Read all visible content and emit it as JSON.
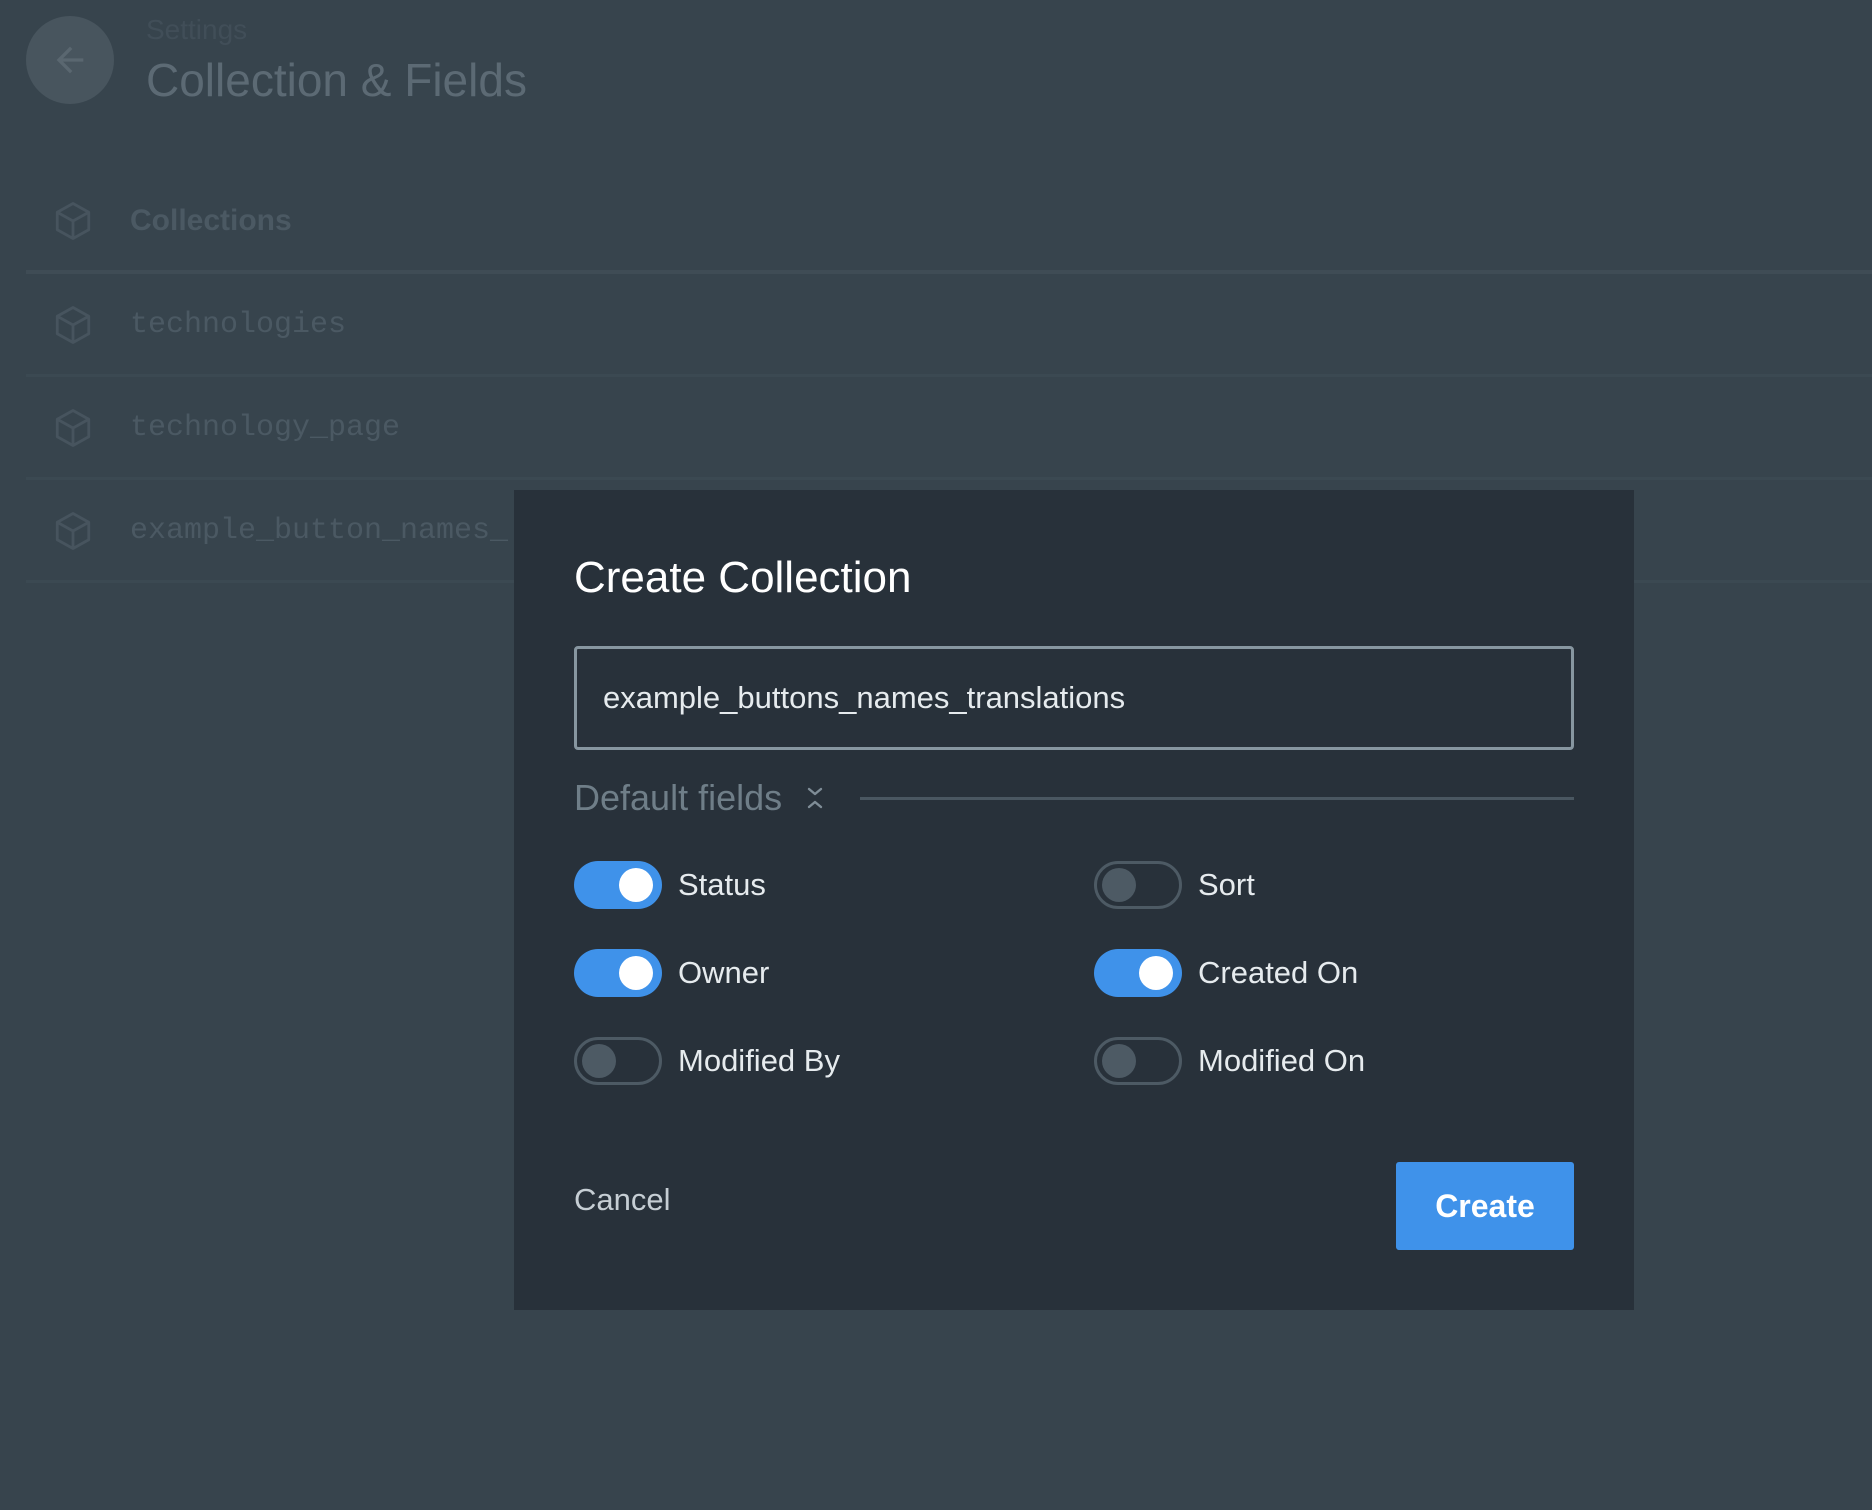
{
  "header": {
    "breadcrumb": "Settings",
    "title": "Collection & Fields",
    "back_icon": "arrow-left-icon"
  },
  "collections": {
    "header_label": "Collections",
    "items": [
      {
        "name": "technologies"
      },
      {
        "name": "technology_page"
      },
      {
        "name": "example_button_names_"
      }
    ],
    "item_icon": "cube-icon"
  },
  "modal": {
    "title": "Create Collection",
    "name_input": {
      "value": "example_buttons_names_translations",
      "placeholder": ""
    },
    "default_fields_label": "Default fields",
    "collapse_icon": "unfold-less-icon",
    "fields": [
      {
        "label": "Status",
        "enabled": true
      },
      {
        "label": "Sort",
        "enabled": false
      },
      {
        "label": "Owner",
        "enabled": true
      },
      {
        "label": "Created On",
        "enabled": true
      },
      {
        "label": "Modified By",
        "enabled": false
      },
      {
        "label": "Modified On",
        "enabled": false
      }
    ],
    "cancel_label": "Cancel",
    "create_label": "Create"
  },
  "colors": {
    "accent": "#3f92ea",
    "modal_bg": "#28313a",
    "page_bg": "#37444d"
  }
}
